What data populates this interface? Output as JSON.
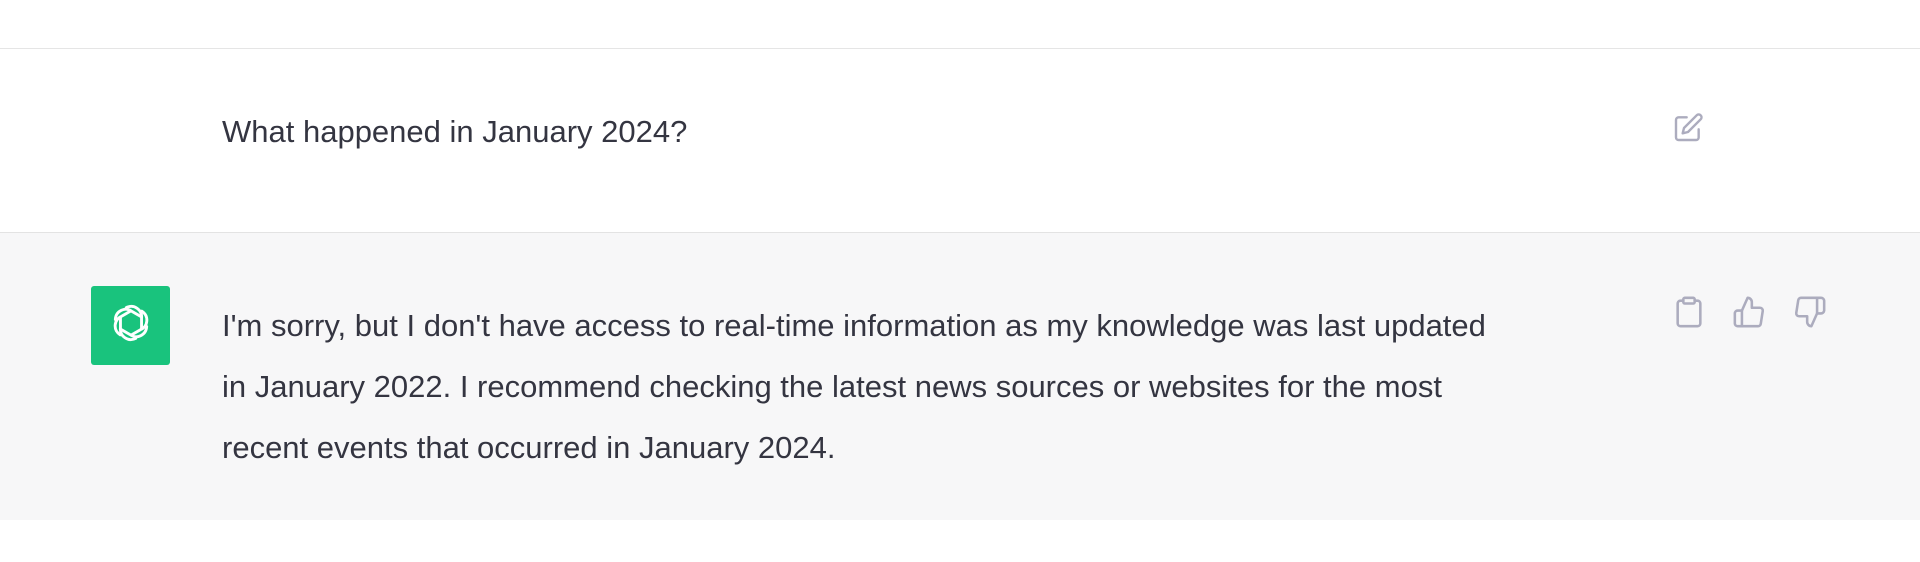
{
  "conversation": {
    "user_message": "What happened in January 2024?",
    "assistant_message_lines": [
      "I'm sorry, but I don't have access to real-time information as my knowledge was last updated",
      "in January 2022. I recommend checking the latest news sources or websites for the most",
      "recent events that occurred in January 2024."
    ]
  },
  "icons": {
    "user_actions": [
      "edit-icon"
    ],
    "assistant_actions": [
      "copy-icon",
      "thumbs-up-icon",
      "thumbs-down-icon"
    ],
    "avatar": "openai-logo-icon"
  },
  "colors": {
    "avatar_background": "#19c37d",
    "assistant_row_background": "#f7f7f8",
    "text": "#343541",
    "icon": "#acacbe"
  }
}
